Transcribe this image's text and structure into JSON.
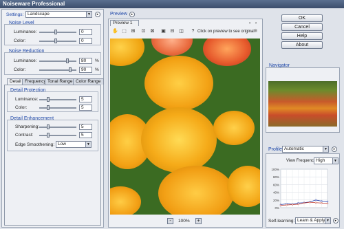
{
  "app": {
    "title": "Noiseware Professional"
  },
  "settings": {
    "label": "Settings:",
    "value": "Landscape"
  },
  "noise_level": {
    "label": "Noise Level",
    "luminance_label": "Luminance:",
    "luminance": "0",
    "color_label": "Color:",
    "color": "0"
  },
  "noise_reduction": {
    "label": "Noise Reduction",
    "luminance_label": "Luminance:",
    "luminance": "80",
    "color_label": "Color:",
    "color": "90",
    "unit": "%"
  },
  "tabs": [
    "Detail",
    "Frequency",
    "Tonal Range",
    "Color Range"
  ],
  "detail_protection": {
    "label": "Detail Protection",
    "luminance_label": "Luminance:",
    "luminance": "5",
    "color_label": "Color:",
    "color": "5"
  },
  "detail_enhancement": {
    "label": "Detail Enhancement",
    "sharpening_label": "Sharpening:",
    "sharpening": "5",
    "contrast_label": "Contrast:",
    "contrast": "5",
    "edge_label": "Edge Smoothening:",
    "edge_value": "Low"
  },
  "preview": {
    "label": "Preview",
    "tab": "Preview 1",
    "hint": "Click on preview to see original",
    "zoom": "100%",
    "zoom_out": "-",
    "zoom_in": "+"
  },
  "buttons": {
    "ok": "OK",
    "cancel": "Cancel",
    "help": "Help",
    "about": "About"
  },
  "navigator": {
    "label": "Navigator"
  },
  "profile": {
    "label": "Profile:",
    "value": "Automatic",
    "view_freq_label": "View Frequency:",
    "view_freq_value": "High",
    "self_learning_label": "Self-learning:",
    "self_learning_value": "Learn & Apply"
  },
  "chart_data": {
    "type": "line",
    "yticks": [
      "100%",
      "80%",
      "60%",
      "40%",
      "20%",
      "0%"
    ],
    "ylim": [
      0,
      100
    ],
    "series": [
      {
        "values": [
          8,
          10,
          9,
          12,
          13,
          15,
          20,
          17,
          16
        ],
        "color": "#1f3aa8"
      },
      {
        "values": [
          6,
          7,
          8,
          9,
          12,
          14,
          13,
          12,
          11
        ],
        "color": "#c0392b"
      }
    ]
  }
}
